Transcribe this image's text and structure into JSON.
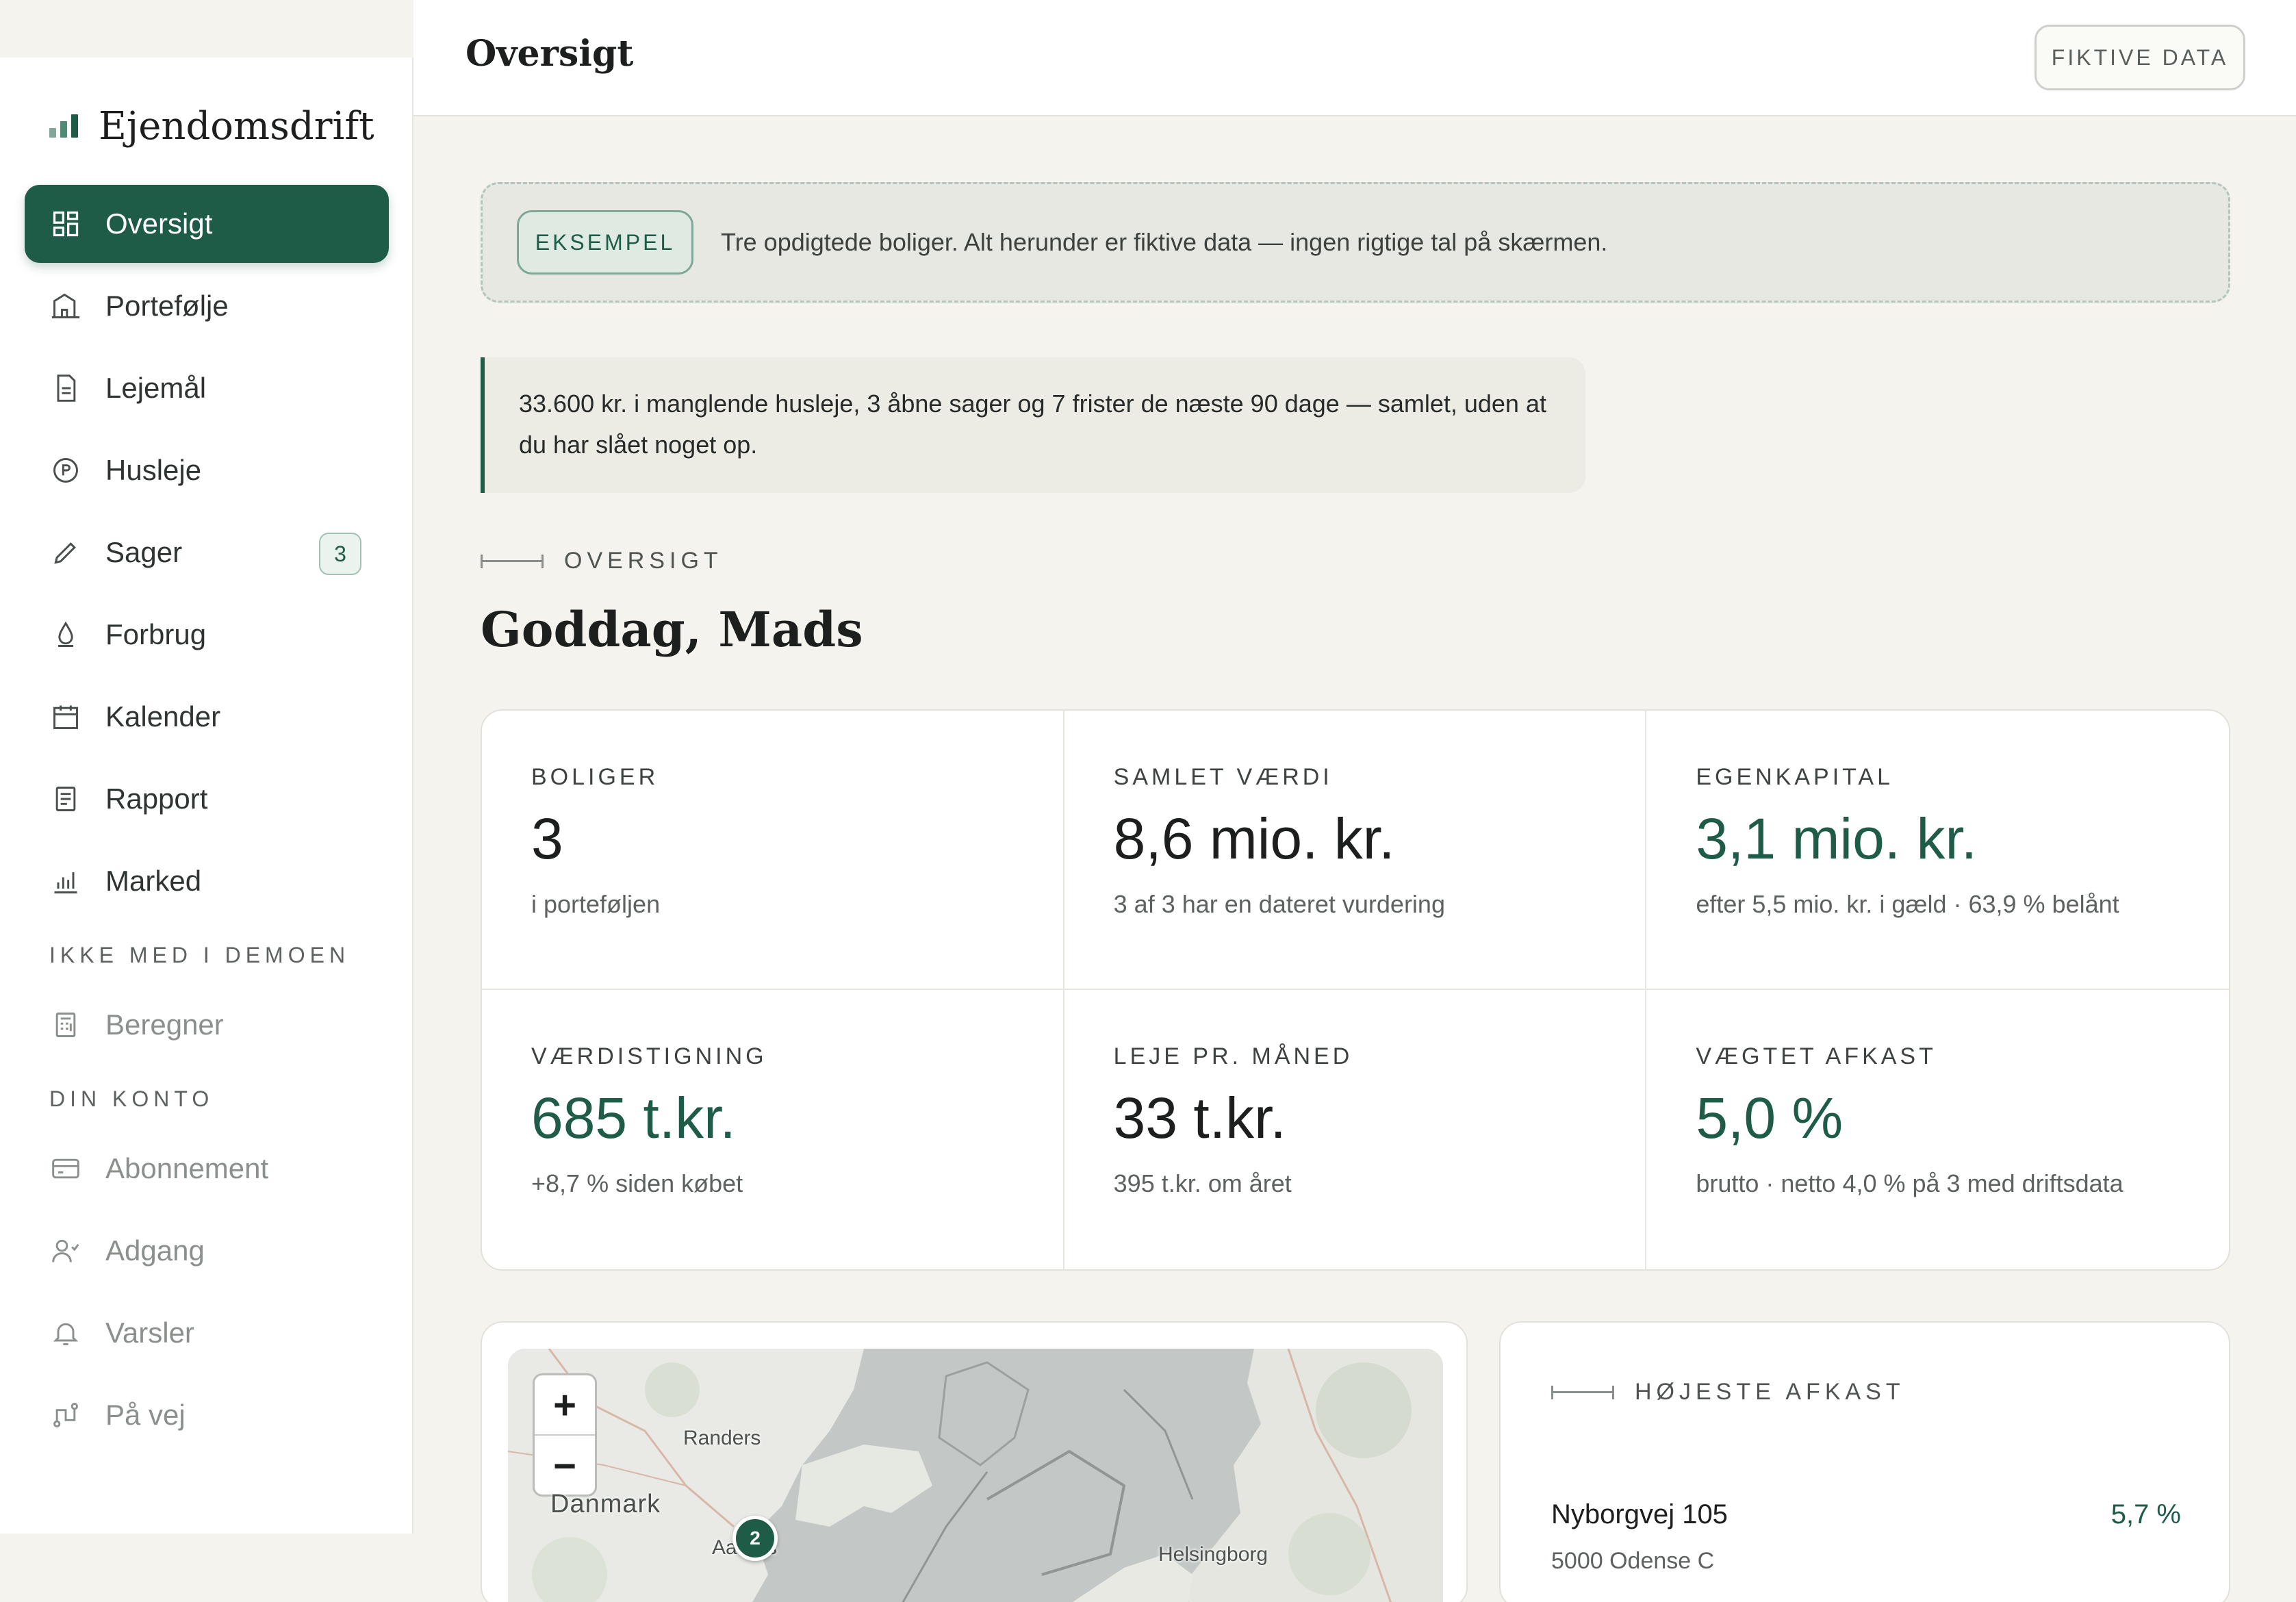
{
  "app": {
    "brand": "Ejendomsdrift"
  },
  "header": {
    "title": "Oversigt",
    "demo_badge": "FIKTIVE DATA"
  },
  "sidebar": {
    "items": [
      {
        "label": "Oversigt",
        "icon": "dashboard-icon"
      },
      {
        "label": "Portefølje",
        "icon": "building-icon"
      },
      {
        "label": "Lejemål",
        "icon": "document-icon"
      },
      {
        "label": "Husleje",
        "icon": "coin-icon"
      },
      {
        "label": "Sager",
        "icon": "pencil-icon",
        "badge": "3"
      },
      {
        "label": "Forbrug",
        "icon": "droplet-icon"
      },
      {
        "label": "Kalender",
        "icon": "calendar-icon"
      },
      {
        "label": "Rapport",
        "icon": "report-icon"
      },
      {
        "label": "Marked",
        "icon": "bar-chart-icon"
      }
    ],
    "section_not_in_demo": "IKKE MED I DEMOEN",
    "not_in_demo_items": [
      {
        "label": "Beregner",
        "icon": "calculator-icon"
      }
    ],
    "section_account": "DIN KONTO",
    "account_items": [
      {
        "label": "Abonnement",
        "icon": "credit-card-icon"
      },
      {
        "label": "Adgang",
        "icon": "user-access-icon"
      },
      {
        "label": "Varsler",
        "icon": "bell-icon"
      },
      {
        "label": "På vej",
        "icon": "route-icon"
      }
    ]
  },
  "banner": {
    "tag": "EKSEMPEL",
    "text": "Tre opdigtede boliger. Alt herunder er fiktive data — ingen rigtige tal på skærmen."
  },
  "note": {
    "line1": "33.600 kr. i manglende husleje, 3 åbne sager og 7 frister de næste 90 dage — samlet, uden at",
    "line2": "du har slået noget op."
  },
  "overview": {
    "section_label": "OVERSIGT",
    "greeting": "Goddag, Mads"
  },
  "kpis": [
    {
      "label": "BOLIGER",
      "value": "3",
      "sub": "i porteføljen",
      "accent": false
    },
    {
      "label": "SAMLET VÆRDI",
      "value": "8,6 mio. kr.",
      "sub": "3 af 3 har en dateret vurdering",
      "accent": false
    },
    {
      "label": "EGENKAPITAL",
      "value": "3,1 mio. kr.",
      "sub": "efter 5,5 mio. kr. i gæld · 63,9 % belånt",
      "accent": true
    },
    {
      "label": "VÆRDISTIGNING",
      "value": "685 t.kr.",
      "sub": "+8,7 % siden købet",
      "accent": true
    },
    {
      "label": "LEJE PR. MÅNED",
      "value": "33 t.kr.",
      "sub": "395 t.kr. om året",
      "accent": false
    },
    {
      "label": "VÆGTET AFKAST",
      "value": "5,0 %",
      "sub": "brutto · netto 4,0 % på 3 med driftsdata",
      "accent": true
    }
  ],
  "map": {
    "zoom_in": "+",
    "zoom_out": "−",
    "labels": {
      "randers": "Randers",
      "denmark": "Danmark",
      "aarhus": "Aarhus",
      "helsingborg": "Helsingborg"
    },
    "marker_count": "2"
  },
  "top_return": {
    "section_label": "HØJESTE AFKAST",
    "items": [
      {
        "address": "Nyborgvej 105",
        "city": "5000 Odense C",
        "value": "5,7 %"
      }
    ]
  },
  "colors": {
    "accent": "#1e5c48",
    "background": "#f4f3ed",
    "card": "#ffffff"
  }
}
